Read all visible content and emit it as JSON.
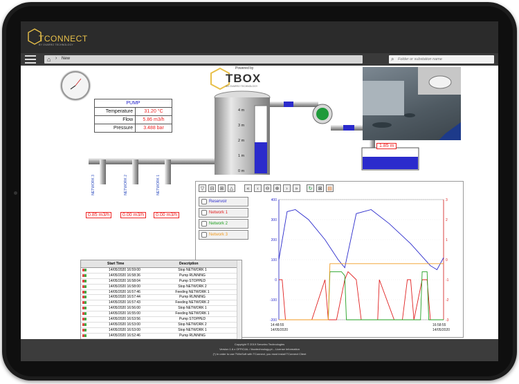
{
  "app": {
    "logo_text": "TCONNECT",
    "logo_sub": "BY OVARRO TECHNOLOGY"
  },
  "nav": {
    "breadcrumb": "New",
    "search_placeholder": "Folder or substation name"
  },
  "tbox": {
    "powered": "Powered by",
    "name": "TBOX",
    "sub": "AN OVARRO TECHNOLOGY"
  },
  "pump": {
    "title": "PUMP",
    "rows": [
      {
        "label": "Temperature",
        "value": "31.20 °C"
      },
      {
        "label": "Flow",
        "value": "5.86 m3/h"
      },
      {
        "label": "Pressure",
        "value": "3.488 bar"
      }
    ]
  },
  "tank": {
    "levels": [
      "4 m",
      "3 m",
      "2 m",
      "1 m",
      "0 m"
    ],
    "reservoir_level": "1.85 m",
    "fill": 0.46
  },
  "networks": [
    {
      "name": "NETWORK 3",
      "flow": "0.85 m3/h",
      "valve_color": "#1e9a3a"
    },
    {
      "name": "NETWORK 2",
      "flow": "0.00 m3/h",
      "valve_color": "#d82828"
    },
    {
      "name": "NETWORK 1",
      "flow": "0.00 m3/h",
      "valve_color": "#d82828"
    }
  ],
  "legend": [
    {
      "name": "Reservoir",
      "color": "#2b2bcc"
    },
    {
      "name": "Network 1",
      "color": "#e02020"
    },
    {
      "name": "Network 2",
      "color": "#20a020"
    },
    {
      "name": "Network 3",
      "color": "#f09a20"
    }
  ],
  "events": {
    "col_start": "Start Time",
    "col_desc": "Description",
    "rows": [
      {
        "time": "14/05/2020 16:59:00",
        "desc": "Stop NETWORK 1"
      },
      {
        "time": "14/05/2020 16:58:36",
        "desc": "Pump RUNNING"
      },
      {
        "time": "14/05/2020 16:58:04",
        "desc": "Pump STOPPED"
      },
      {
        "time": "14/05/2020 16:58:00",
        "desc": "Stop NETWORK 2"
      },
      {
        "time": "14/05/2020 16:57:46",
        "desc": "Feeding NETWORK 1"
      },
      {
        "time": "14/05/2020 16:57:44",
        "desc": "Pump RUNNING"
      },
      {
        "time": "14/05/2020 16:57:43",
        "desc": "Feeding NETWORK 2"
      },
      {
        "time": "14/05/2020 16:56:00",
        "desc": "Stop NETWORK 1"
      },
      {
        "time": "14/05/2020 16:55:00",
        "desc": "Feeding NETWORK 1"
      },
      {
        "time": "14/05/2020 16:53:56",
        "desc": "Pump STOPPED"
      },
      {
        "time": "14/05/2020 16:53:00",
        "desc": "Stop NETWORK 2"
      },
      {
        "time": "14/05/2020 16:53:00",
        "desc": "Stop NETWORK 1"
      },
      {
        "time": "14/05/2020 16:52:46",
        "desc": "Pump RUNNING"
      }
    ]
  },
  "chart_data": {
    "type": "line",
    "x_start": "14:48:55 14/05/2020",
    "x_end": "16:58:55 14/05/2020",
    "x_start_time": "14:48:55",
    "x_start_date": "14/05/2020",
    "x_end_time": "16:58:55",
    "x_end_date": "14/05/2020",
    "y_left": {
      "ticks": [
        400,
        300,
        200,
        100,
        0,
        -100,
        -200
      ],
      "range": [
        -200,
        400
      ]
    },
    "y_right": {
      "ticks": [
        3,
        2,
        1,
        0,
        -1,
        -2,
        -3
      ],
      "range": [
        -3,
        3
      ]
    },
    "series": [
      {
        "name": "Reservoir",
        "axis": "left",
        "color": "#2b2bcc",
        "x": [
          0,
          0.05,
          0.1,
          0.18,
          0.28,
          0.36,
          0.4,
          0.47,
          0.56,
          0.67,
          0.8,
          0.92,
          0.96,
          1
        ],
        "y": [
          100,
          340,
          350,
          300,
          200,
          100,
          60,
          330,
          350,
          280,
          180,
          70,
          50,
          110
        ]
      },
      {
        "name": "Network 1",
        "axis": "left",
        "color": "#e02020",
        "x": [
          0,
          0.02,
          0.04,
          0.2,
          0.28,
          0.3,
          0.35,
          0.4,
          0.42,
          0.47,
          0.5,
          0.52,
          0.6,
          0.61,
          0.7,
          0.75,
          0.78,
          0.8,
          0.82,
          0.87,
          0.9,
          0.92,
          0.98,
          1
        ],
        "y": [
          0,
          0,
          -200,
          -200,
          0,
          -200,
          -200,
          0,
          40,
          0,
          -200,
          -200,
          -200,
          0,
          -200,
          -200,
          0,
          0,
          -200,
          0,
          0,
          -200,
          -200,
          -200
        ]
      },
      {
        "name": "Network 2",
        "axis": "left",
        "color": "#20a020",
        "x": [
          0,
          0.3,
          0.31,
          0.38,
          0.4,
          0.41,
          0.86,
          0.87,
          0.9,
          0.91,
          1
        ],
        "y": [
          -200,
          -200,
          40,
          40,
          20,
          -200,
          -200,
          40,
          40,
          -200,
          -200
        ]
      },
      {
        "name": "Network 3",
        "axis": "left",
        "color": "#f09a20",
        "x": [
          0,
          0.3,
          0.31,
          0.96,
          1
        ],
        "y": [
          -200,
          -200,
          80,
          80,
          80
        ]
      }
    ]
  },
  "footer": {
    "line1": "Copyright © 2019 Servelec Technologies",
    "line2": "Version 1.6.x OFFICIAL / tboxtechnology.pt – License Information",
    "line3": "(*) In order to use TWinSoft with TConnect, you must install TConnect Client"
  }
}
